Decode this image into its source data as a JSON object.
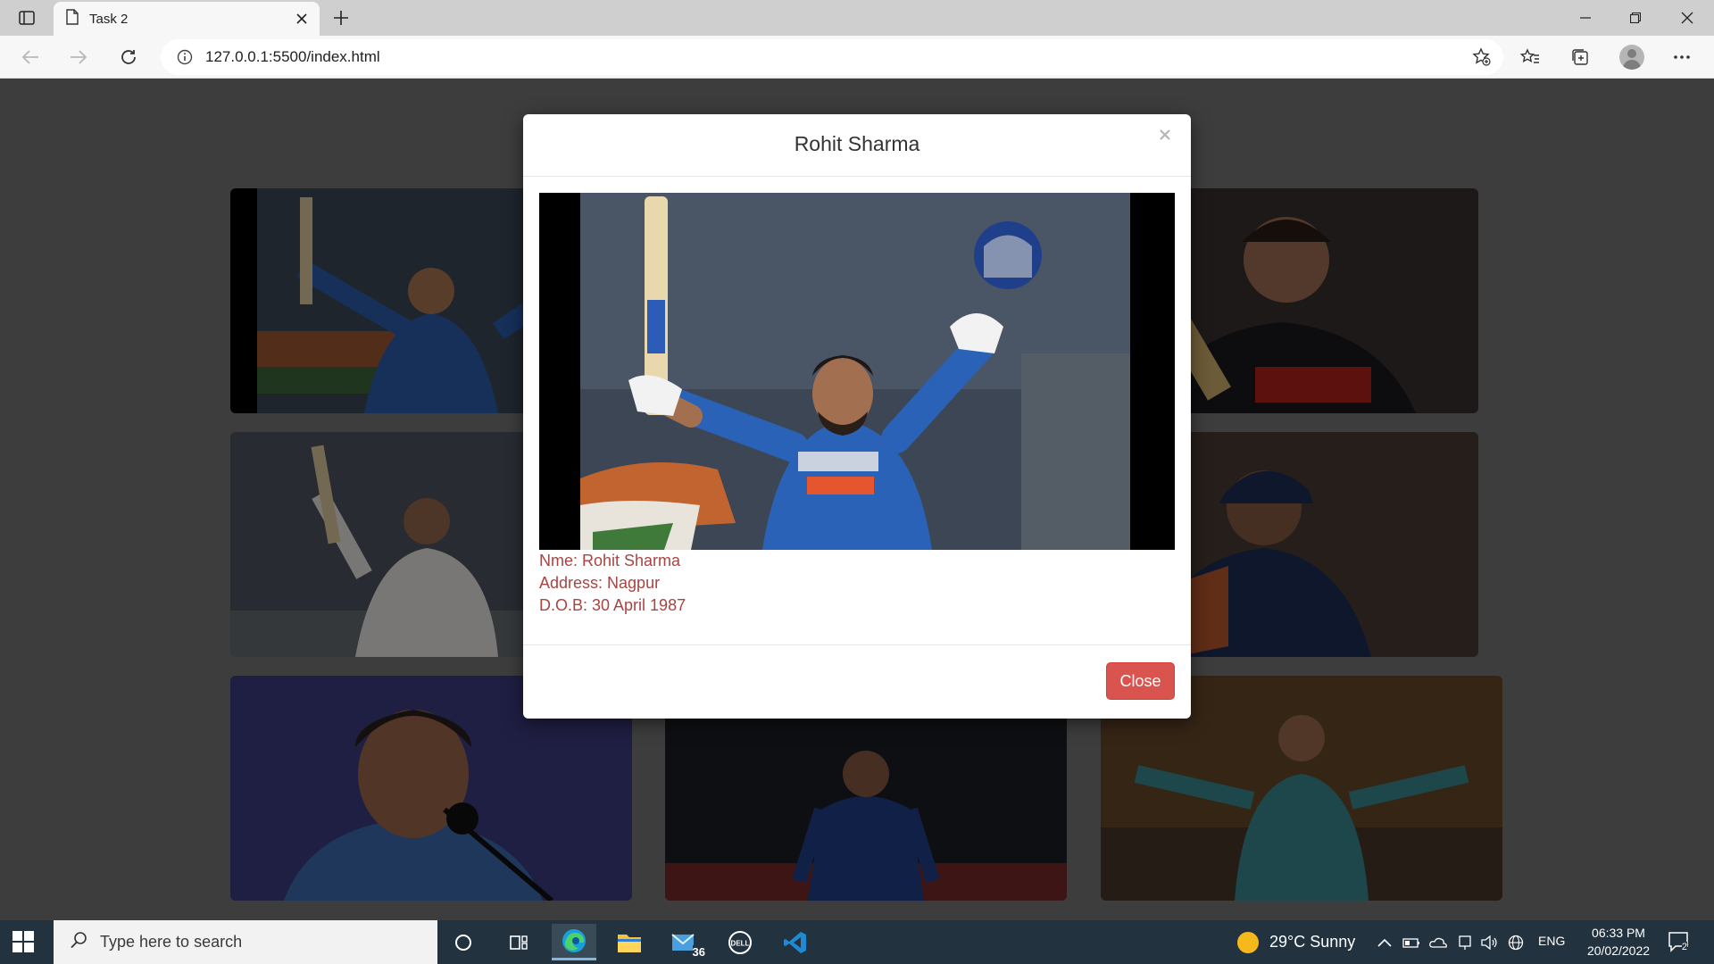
{
  "browser": {
    "tab_title": "Task 2",
    "url": "127.0.0.1:5500/index.html"
  },
  "modal": {
    "title": "Rohit Sharma",
    "close_x": "×",
    "details": [
      "Nme: Rohit Sharma",
      "Address: Nagpur",
      "D.O.B: 30 April 1987"
    ],
    "close_label": "Close"
  },
  "gallery": {
    "count": 9
  },
  "taskbar": {
    "search_placeholder": "Type here to search",
    "mail_count": "36",
    "weather": "29°C  Sunny",
    "language": "ENG",
    "time": "06:33 PM",
    "date": "20/02/2022",
    "notifications": "2"
  },
  "colors": {
    "detail_text": "#a94442",
    "close_button": "#d9534f",
    "taskbar": "#22323f"
  }
}
